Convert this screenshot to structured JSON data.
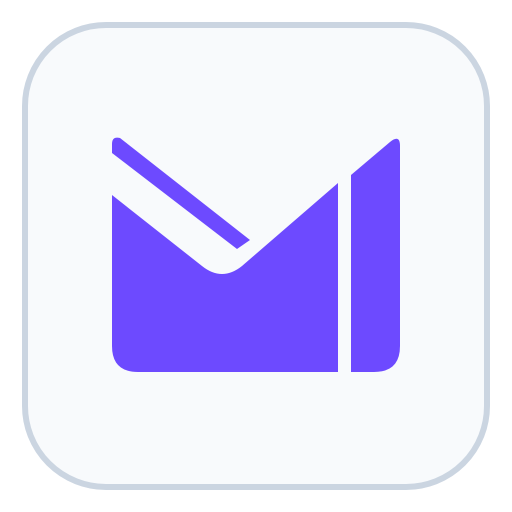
{
  "app_icon": {
    "icon": "envelope-m-logo",
    "colors": {
      "tile_background": "#F8FAFC",
      "tile_border": "#CBD5E1",
      "logo": "#6D4AFF"
    }
  }
}
